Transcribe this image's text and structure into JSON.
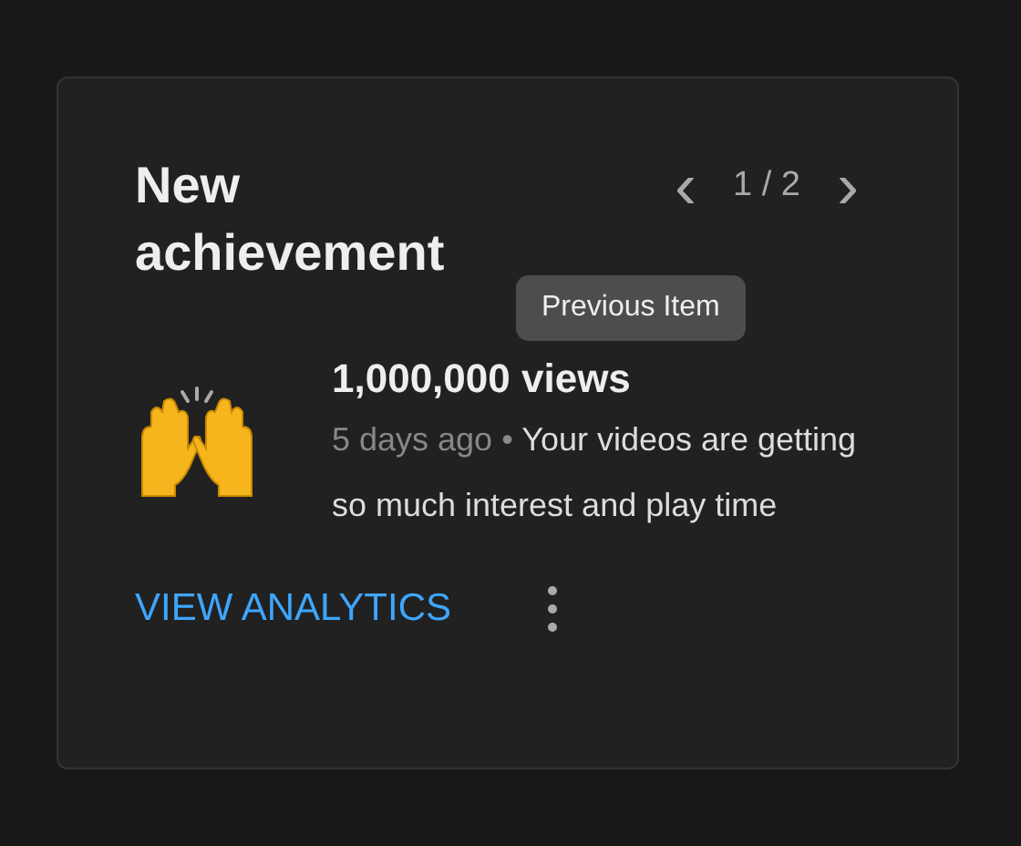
{
  "card": {
    "title": "New achievement",
    "pager": {
      "previous": "‹",
      "position": "1 / 2",
      "next": "›"
    },
    "tooltip": "Previous Item",
    "achievement": {
      "heading": "1,000,000 views",
      "age": "5 days ago",
      "separator": "•",
      "description": "Your videos are getting so much interest and play time"
    },
    "action": "VIEW ANALYTICS"
  }
}
